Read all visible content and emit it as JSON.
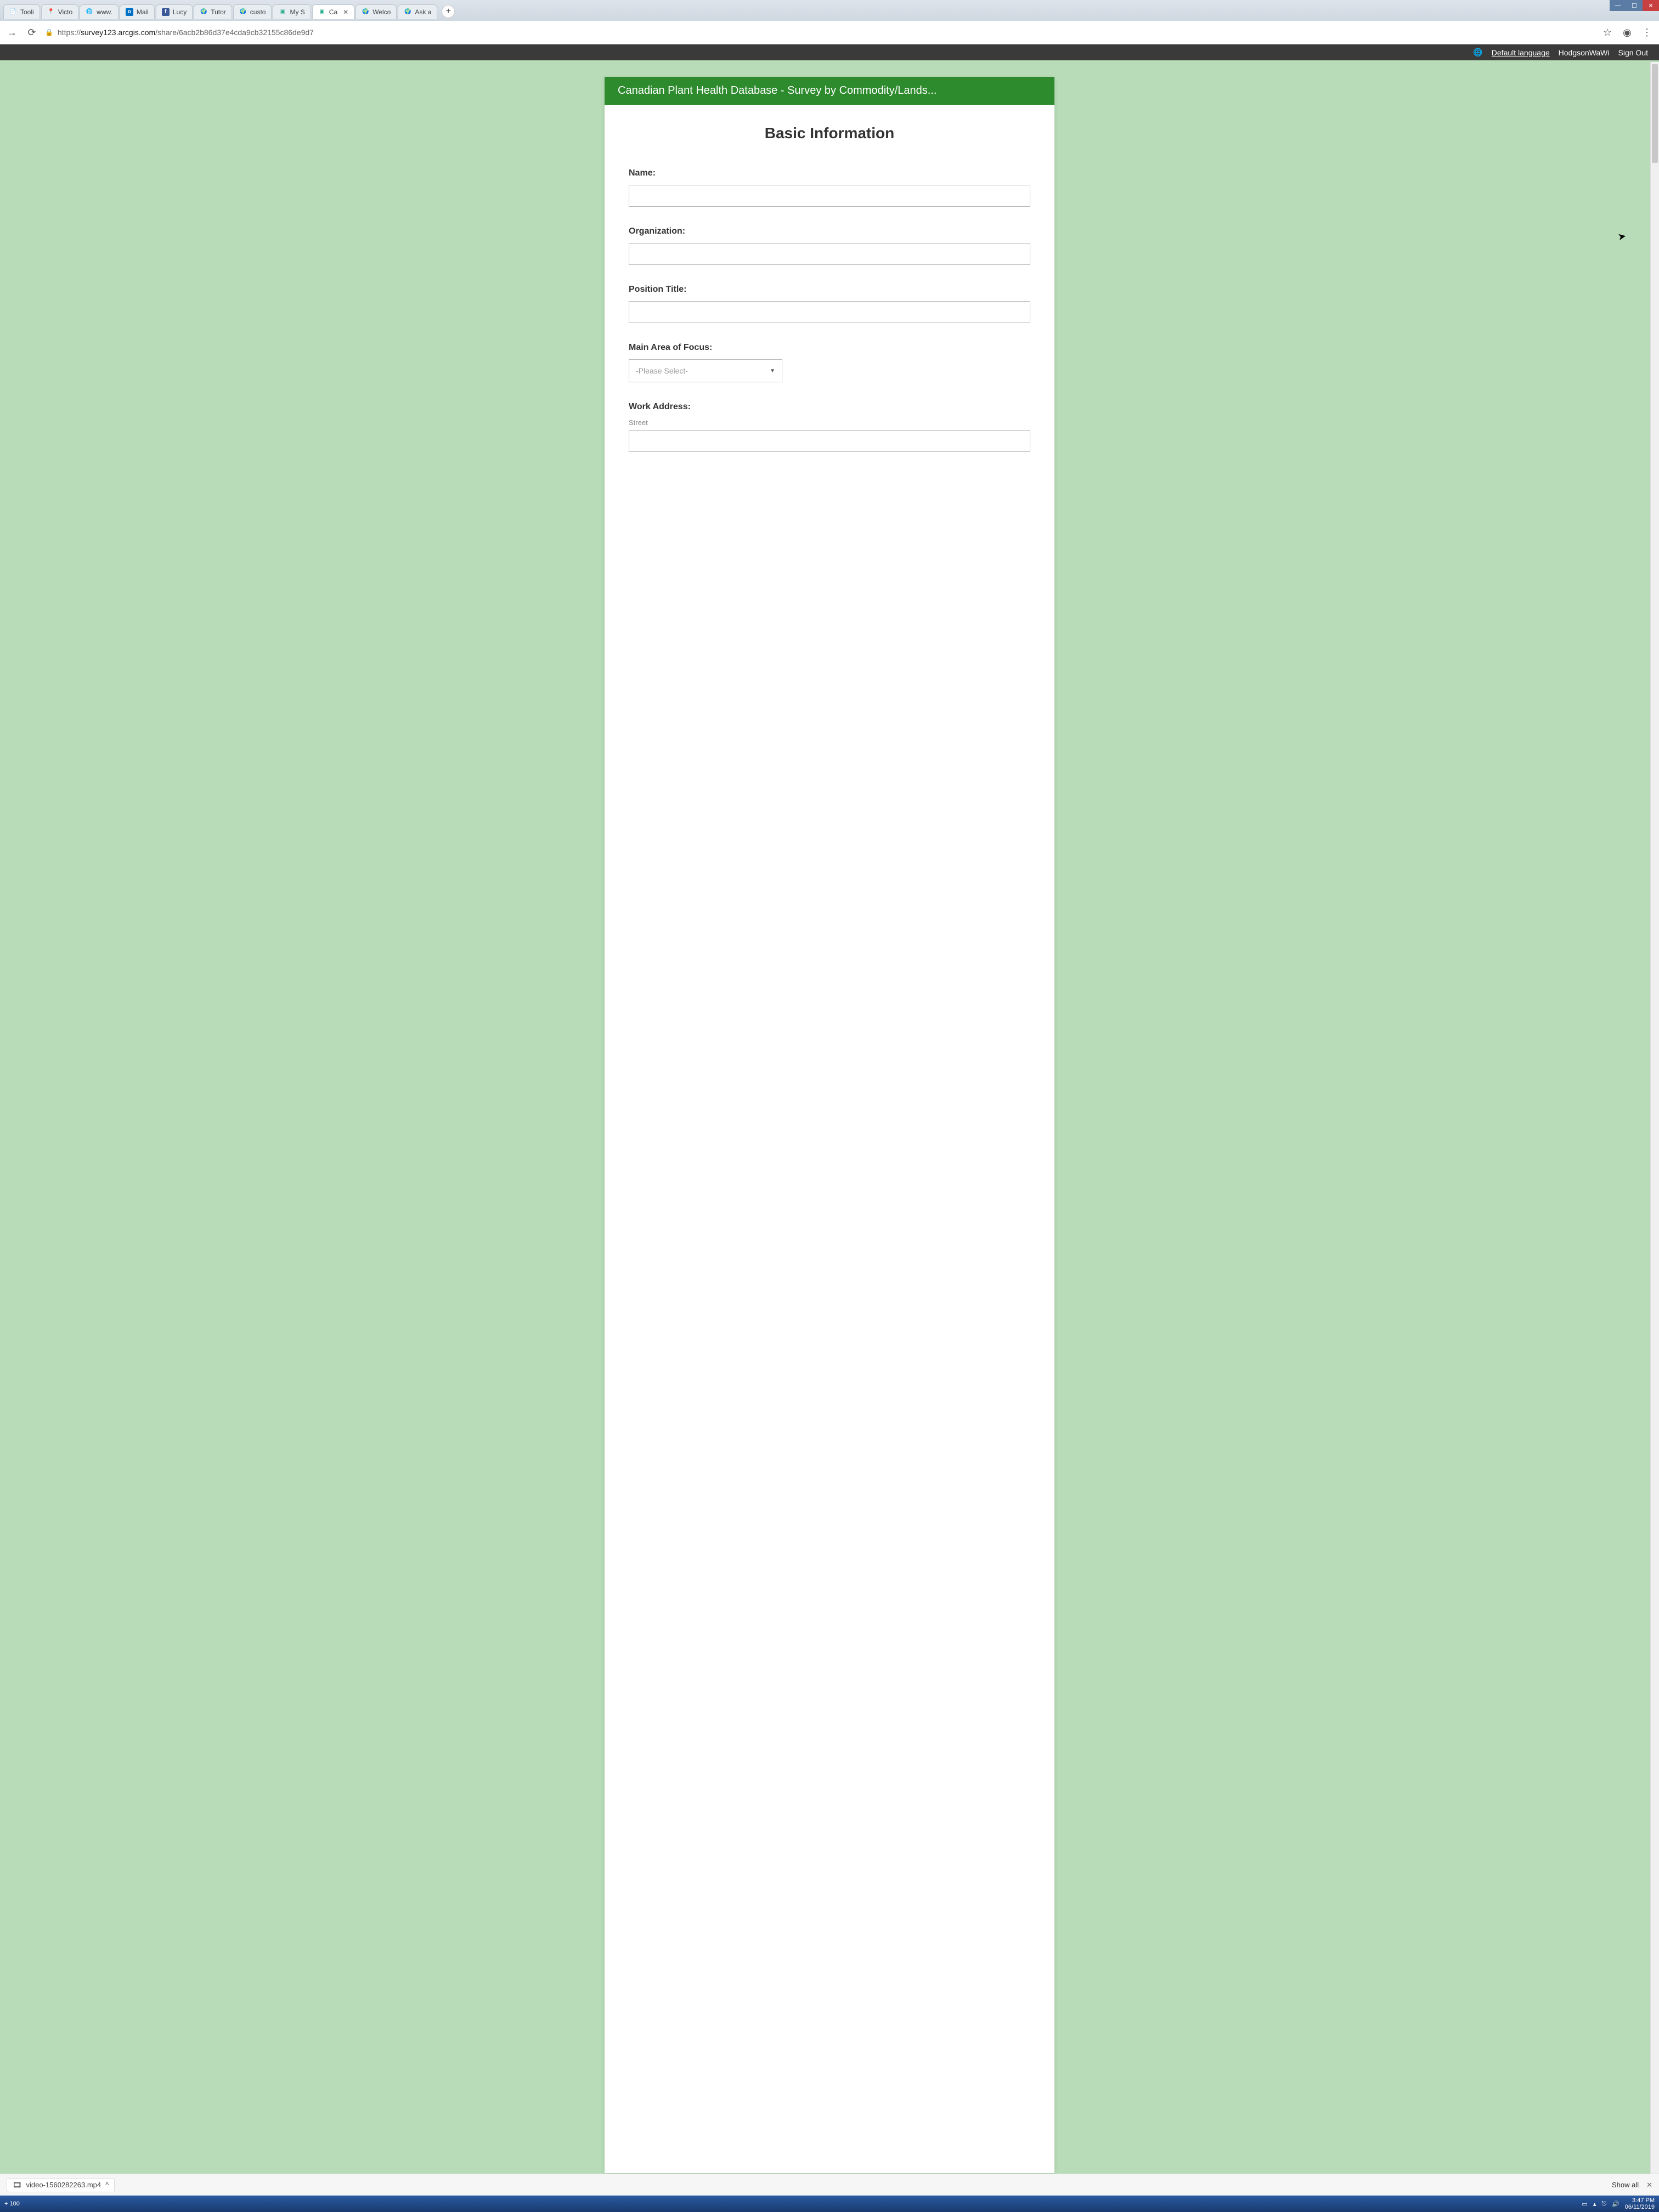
{
  "browser": {
    "tabs": [
      {
        "label": "Tooli"
      },
      {
        "label": "Victo"
      },
      {
        "label": "www."
      },
      {
        "label": "Mail"
      },
      {
        "label": "Lucy"
      },
      {
        "label": "Tutor"
      },
      {
        "label": "custo"
      },
      {
        "label": "My S"
      },
      {
        "label": "Ca",
        "active": true,
        "closeable": true
      },
      {
        "label": "Welco"
      },
      {
        "label": "Ask a"
      }
    ],
    "new_tab": "+",
    "nav": {
      "forward": "→",
      "reload": "⟳"
    },
    "url_prefix": "https://",
    "url_domain": "survey123.arcgis.com",
    "url_path": "/share/6acb2b86d37e4cda9cb32155c86de9d7",
    "star": "☆",
    "user": "◉",
    "more": "⋮"
  },
  "appbar": {
    "language_label": "Default language",
    "username": "HodgsonWaWi",
    "signout": "Sign Out"
  },
  "form": {
    "title": "Canadian Plant Health Database - Survey by Commodity/Lands...",
    "section": "Basic Information",
    "fields": {
      "name": {
        "label": "Name:",
        "value": ""
      },
      "organization": {
        "label": "Organization:",
        "value": ""
      },
      "position": {
        "label": "Position Title:",
        "value": ""
      },
      "focus": {
        "label": "Main Area of Focus:",
        "placeholder": "-Please Select-"
      },
      "address": {
        "label": "Work Address:",
        "sublabel": "Street",
        "value": ""
      }
    }
  },
  "downloads": {
    "item": "video-1560282263.mp4",
    "chevron": "^",
    "show_all": "Show all",
    "close": "✕"
  },
  "taskbar": {
    "left": "+  100",
    "time": "3:47 PM",
    "date": "06/11/2019"
  },
  "window": {
    "min": "—",
    "max": "☐",
    "close": "✕"
  }
}
